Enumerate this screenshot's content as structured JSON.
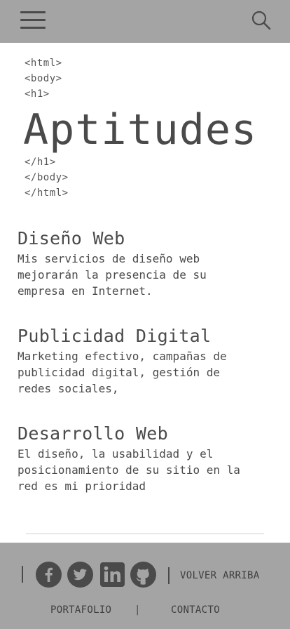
{
  "header": {
    "menu_icon": "hamburger-menu-icon",
    "search_icon": "search-icon"
  },
  "code": {
    "open_html": "<html>",
    "open_body": "<body>",
    "open_h1": "<h1>",
    "close_h1": "</h1>",
    "close_body": "</body>",
    "close_html": "</html>"
  },
  "title": "Aptitudes",
  "skills": [
    {
      "title": "Diseño Web",
      "description": "Mis servicios de diseño web\nmejorarán  la presencia de su\nempresa en Internet."
    },
    {
      "title": "Publicidad Digital",
      "description": "Marketing efectivo, campañas de\npublicidad digital, gestión de\nredes sociales,"
    },
    {
      "title": "Desarrollo Web",
      "description": "El diseño, la usabilidad y el\nposicionamiento de su sitio en la\nred es mi prioridad"
    }
  ],
  "footer": {
    "social_icons": [
      "facebook-icon",
      "twitter-icon",
      "linkedin-icon",
      "github-icon"
    ],
    "back_to_top": "VOLVER ARRIBA",
    "portfolio": "PORTAFOLIO",
    "separator": "|",
    "contact": "CONTACTO"
  },
  "colors": {
    "bar_background": "#a4a4a4",
    "text": "#4a4a4a",
    "page_background": "#ffffff"
  }
}
